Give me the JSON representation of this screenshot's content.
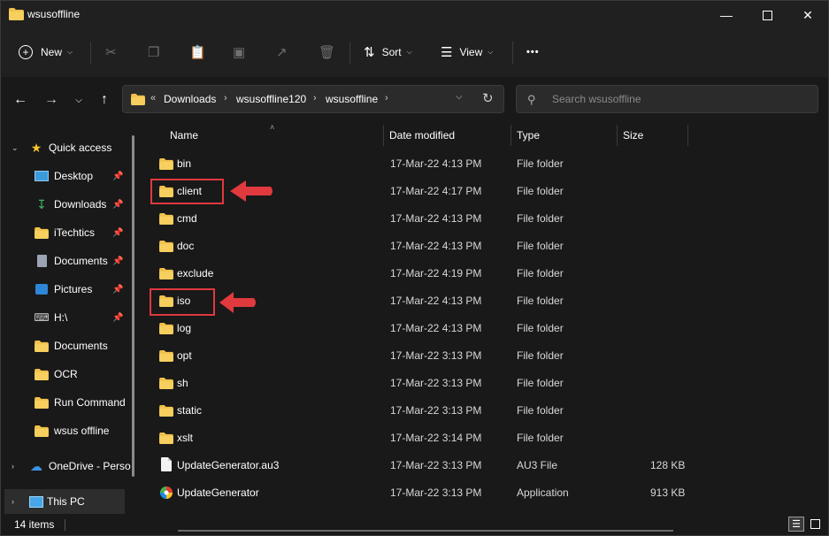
{
  "window": {
    "title": "wsusoffline",
    "minimize_icon": "minimize-icon",
    "maximize_icon": "maximize-icon",
    "close_icon": "close-icon"
  },
  "toolbar": {
    "new_label": "New",
    "sort_label": "Sort",
    "view_label": "View",
    "more_label": "•••"
  },
  "address": {
    "overflow": "«",
    "segments": [
      "Downloads",
      "wsusoffline120",
      "wsusoffline"
    ]
  },
  "search": {
    "placeholder": "Search wsusoffline"
  },
  "sidebar": {
    "items": [
      {
        "label": "Quick access",
        "icon": "star-icon",
        "pinned": false
      },
      {
        "label": "Desktop",
        "icon": "desktop-icon",
        "pinned": true
      },
      {
        "label": "Downloads",
        "icon": "download-icon",
        "pinned": true
      },
      {
        "label": "iTechtics",
        "icon": "folder-icon",
        "pinned": true
      },
      {
        "label": "Documents",
        "icon": "documents-icon",
        "pinned": true
      },
      {
        "label": "Pictures",
        "icon": "pictures-icon",
        "pinned": true
      },
      {
        "label": "H:\\",
        "icon": "drive-icon",
        "pinned": true
      },
      {
        "label": "Documents",
        "icon": "folder-icon",
        "pinned": false
      },
      {
        "label": "OCR",
        "icon": "folder-icon",
        "pinned": false
      },
      {
        "label": "Run Command",
        "icon": "folder-icon",
        "pinned": false
      },
      {
        "label": "wsus offline",
        "icon": "folder-icon",
        "pinned": false
      },
      {
        "label": "OneDrive - Perso",
        "icon": "cloud-icon",
        "pinned": false
      },
      {
        "label": "This PC",
        "icon": "pc-icon",
        "pinned": false
      }
    ]
  },
  "columns": {
    "name": "Name",
    "date": "Date modified",
    "type": "Type",
    "size": "Size"
  },
  "rows": [
    {
      "name": "bin",
      "date": "17-Mar-22 4:13 PM",
      "type": "File folder",
      "size": "",
      "kind": "folder"
    },
    {
      "name": "client",
      "date": "17-Mar-22 4:17 PM",
      "type": "File folder",
      "size": "",
      "kind": "folder"
    },
    {
      "name": "cmd",
      "date": "17-Mar-22 4:13 PM",
      "type": "File folder",
      "size": "",
      "kind": "folder"
    },
    {
      "name": "doc",
      "date": "17-Mar-22 4:13 PM",
      "type": "File folder",
      "size": "",
      "kind": "folder"
    },
    {
      "name": "exclude",
      "date": "17-Mar-22 4:19 PM",
      "type": "File folder",
      "size": "",
      "kind": "folder"
    },
    {
      "name": "iso",
      "date": "17-Mar-22 4:13 PM",
      "type": "File folder",
      "size": "",
      "kind": "folder"
    },
    {
      "name": "log",
      "date": "17-Mar-22 4:13 PM",
      "type": "File folder",
      "size": "",
      "kind": "folder"
    },
    {
      "name": "opt",
      "date": "17-Mar-22 3:13 PM",
      "type": "File folder",
      "size": "",
      "kind": "folder"
    },
    {
      "name": "sh",
      "date": "17-Mar-22 3:13 PM",
      "type": "File folder",
      "size": "",
      "kind": "folder"
    },
    {
      "name": "static",
      "date": "17-Mar-22 3:13 PM",
      "type": "File folder",
      "size": "",
      "kind": "folder"
    },
    {
      "name": "xslt",
      "date": "17-Mar-22 3:14 PM",
      "type": "File folder",
      "size": "",
      "kind": "folder"
    },
    {
      "name": "UpdateGenerator.au3",
      "date": "17-Mar-22 3:13 PM",
      "type": "AU3 File",
      "size": "128 KB",
      "kind": "file"
    },
    {
      "name": "UpdateGenerator",
      "date": "17-Mar-22 3:13 PM",
      "type": "Application",
      "size": "913 KB",
      "kind": "app"
    }
  ],
  "status": {
    "items_count": "14 items"
  },
  "colors": {
    "accent": "#e0393e",
    "folder": "#f0c14b",
    "background": "#191919"
  }
}
